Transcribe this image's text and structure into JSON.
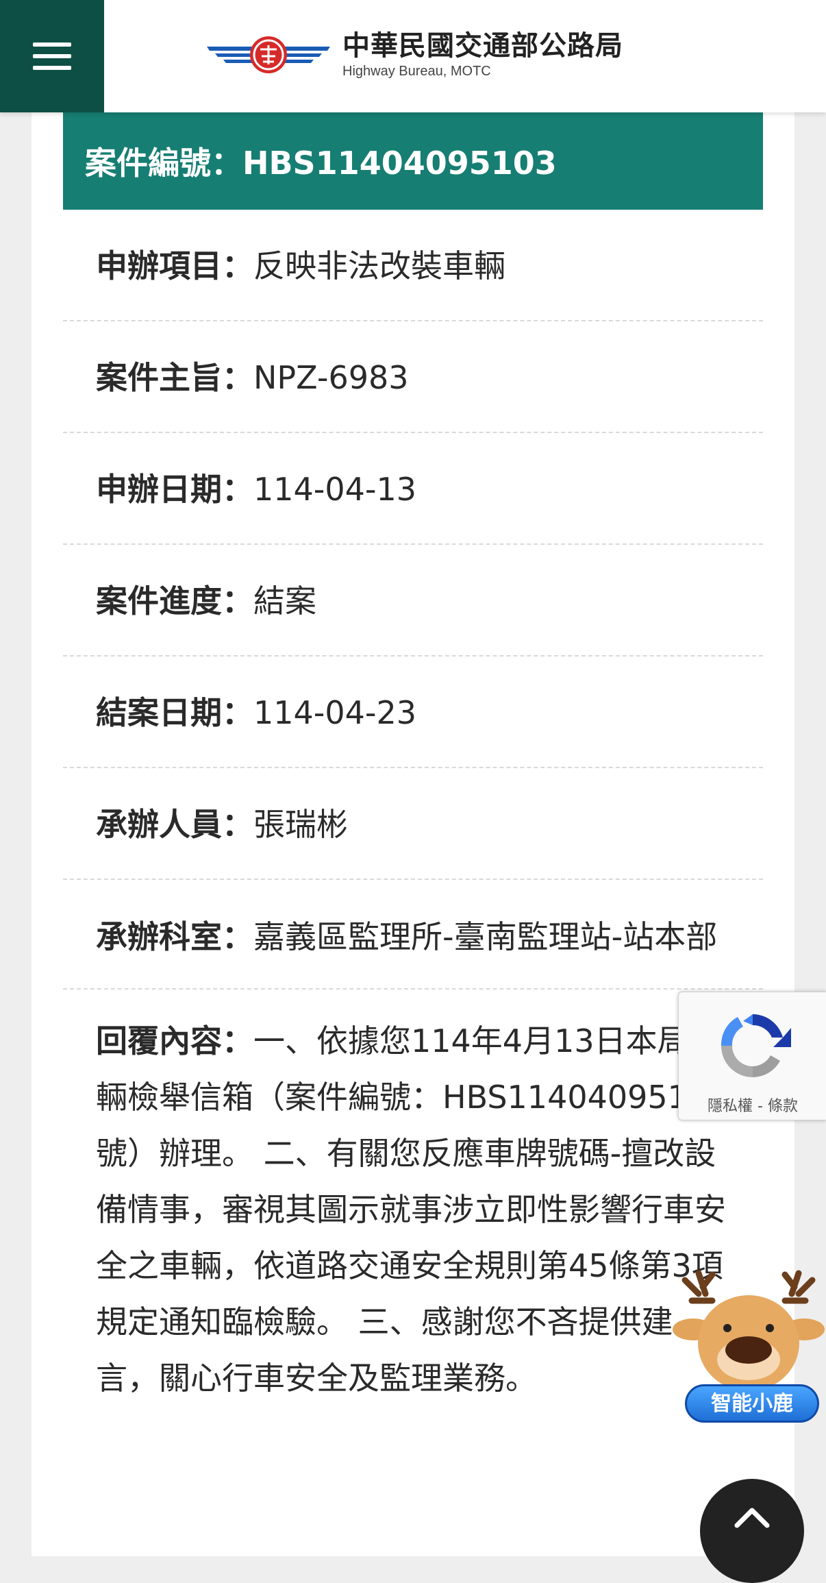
{
  "header": {
    "menu_label": "menu",
    "org_name_zh": "中華民國交通部公路局",
    "org_name_en": "Highway Bureau, MOTC"
  },
  "case": {
    "title_label": "案件編號：",
    "case_number": "HBS11404095103",
    "fields": [
      {
        "label": "申辦項目：",
        "value": "反映非法改裝車輛"
      },
      {
        "label": "案件主旨：",
        "value": "NPZ-6983"
      },
      {
        "label": "申辦日期：",
        "value": "114-04-13"
      },
      {
        "label": "案件進度：",
        "value": "結案"
      },
      {
        "label": "結案日期：",
        "value": "114-04-23"
      },
      {
        "label": "承辦人員：",
        "value": "張瑞彬"
      },
      {
        "label": "承辦科室：",
        "value": "嘉義區監理所-臺南監理站-站本部"
      },
      {
        "label": "回覆內容：",
        "value": "一、依據您114年4月13日本局車輛檢舉信箱（案件編號：HBS11404095103號）辦理。 二、有關您反應車牌號碼-擅改設備情事，審視其圖示就事涉立即性影響行車安全之車輛，依道路交通安全規則第45條第3項規定通知臨檢驗。 三、感謝您不吝提供建言，關心行車安全及監理業務。"
      }
    ]
  },
  "recaptcha": {
    "links": "隱私權 - 條款"
  },
  "assistant": {
    "label": "智能小鹿"
  },
  "colors": {
    "menu_bg": "#0d4f45",
    "case_header_bg": "#167e72",
    "assistant_blue": "#1f6fd6"
  }
}
